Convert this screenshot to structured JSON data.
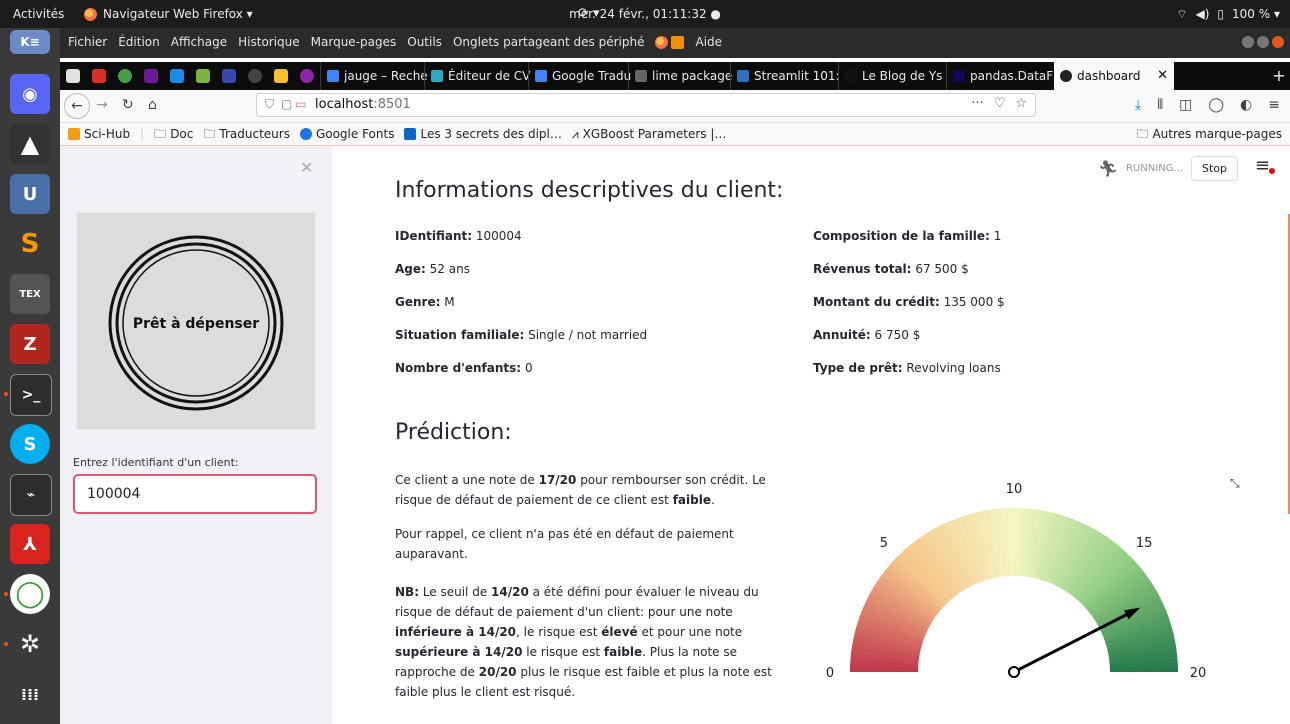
{
  "topbar": {
    "activities": "Activités",
    "app": "Navigateur Web Firefox ▾",
    "clock": "mer. 24 févr., 01:11:32 ●",
    "reload": "⟳ ▾",
    "battery": "100 % ▾"
  },
  "menubar": {
    "items": [
      "Fichier",
      "Édition",
      "Affichage",
      "Historique",
      "Marque-pages",
      "Outils",
      "Onglets partageant des périphé",
      "Aide"
    ]
  },
  "tabs": [
    {
      "label": "jauge – Reche",
      "color": "#4285f4"
    },
    {
      "label": "Éditeur de CV",
      "color": "#2aa8c4"
    },
    {
      "label": "Google Tradu",
      "color": "#4285f4"
    },
    {
      "label": "lime package",
      "color": "#666666"
    },
    {
      "label": "Streamlit 101:",
      "color": "#2f6fbf"
    },
    {
      "label": "Le Blog de Ys",
      "color": "#111111"
    },
    {
      "label": "pandas.DataF",
      "color": "#150458"
    },
    {
      "label": "dashboard",
      "color": "#222222"
    }
  ],
  "navbar": {
    "url_host": "localhost",
    "url_port": ":8501",
    "more": "···"
  },
  "bookmarks": {
    "items": [
      {
        "label": "Sci-Hub",
        "color": "#f39c12"
      },
      {
        "label": "Doc",
        "color": "#777777"
      },
      {
        "label": "Traducteurs",
        "color": "#777777"
      },
      {
        "label": "Google Fonts",
        "color": "#1a73e8"
      },
      {
        "label": "Les 3 secrets des dipl…",
        "color": "#0a66c2"
      },
      {
        "label": "XGBoost Parameters |…",
        "color": "#555555"
      }
    ],
    "other": "Autres marque-pages"
  },
  "sidebar": {
    "logo_text": "Prêt à dépenser",
    "input_label": "Entrez l'identifiant d'un client:",
    "input_value": "100004"
  },
  "status": {
    "running": "RUNNING...",
    "stop": "Stop"
  },
  "client": {
    "title": "Informations descriptives du client:",
    "left": [
      {
        "label": "IDentifiant:",
        "value": "100004"
      },
      {
        "label": "Age:",
        "value": "52 ans"
      },
      {
        "label": "Genre:",
        "value": "M"
      },
      {
        "label": "Situation familiale:",
        "value": "Single / not married"
      },
      {
        "label": "Nombre d'enfants:",
        "value": "0"
      }
    ],
    "right": [
      {
        "label": "Composition de la famille:",
        "value": "1"
      },
      {
        "label": "Révenus total:",
        "value": "67 500 $"
      },
      {
        "label": "Montant du crédit:",
        "value": "135 000 $"
      },
      {
        "label": "Annuité:",
        "value": "6 750 $"
      },
      {
        "label": "Type de prêt:",
        "value": "Revolving loans"
      }
    ]
  },
  "prediction": {
    "title": "Prédiction:",
    "p1": {
      "a": "Ce client a une note de ",
      "score": "17/20",
      "b": " pour rembourser son crédit. Le risque de défaut de paiement de ce client est ",
      "risk": "faible",
      "c": "."
    },
    "p2": "Pour rappel, ce client n'a pas été en défaut de paiement auparavant.",
    "nb": {
      "label": "NB:",
      "t1": " Le seuil de ",
      "threshold": "14/20",
      "t2": " a été défini pour évaluer le niveau du risque de défaut de paiement d'un client: pour une note ",
      "lower": "inférieure à 14/20",
      "t3": ", le risque est ",
      "high": "élevé",
      "t4": " et pour une note ",
      "upper": "supérieure à 14/20",
      "t5": " le risque est ",
      "low": "faible",
      "t6": ". Plus la note se rapproche de ",
      "max": "20/20",
      "t7": " plus le risque est faible et plus la note est faible plus le client est risqué."
    }
  },
  "gauge": {
    "min": 0,
    "max": 20,
    "value": 17,
    "ticks": [
      "0",
      "5",
      "10",
      "15",
      "20"
    ],
    "colors": [
      "#c0354b",
      "#f6c68a",
      "#f4f6c4",
      "#95cf84",
      "#24794a"
    ]
  }
}
